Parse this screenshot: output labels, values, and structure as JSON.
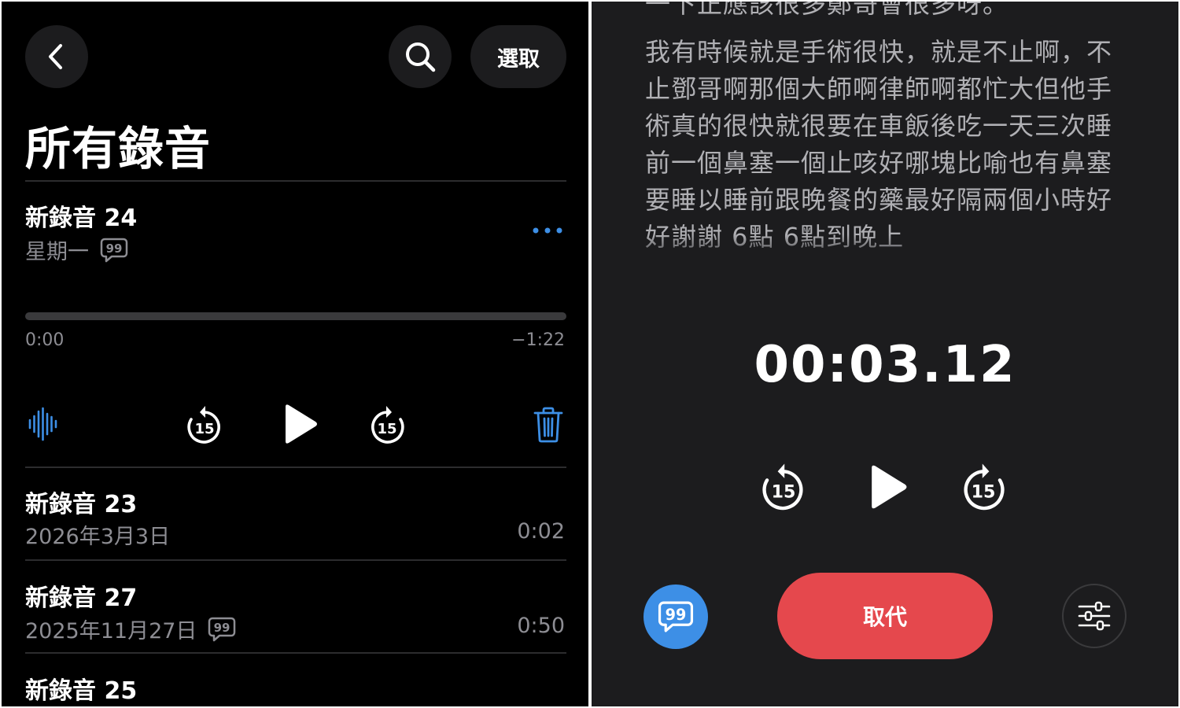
{
  "left_panel": {
    "header": {
      "select_label": "選取"
    },
    "title": "所有錄音",
    "expanded_recording": {
      "name": "新錄音 24",
      "date": "星期一",
      "progress_fraction": 0,
      "elapsed": "0:00",
      "remaining": "−1:22"
    },
    "recordings": [
      {
        "name": "新錄音 23",
        "date": "2026年3月3日",
        "duration": "0:02",
        "has_transcript": false
      },
      {
        "name": "新錄音 27",
        "date": "2025年11月27日",
        "duration": "0:50",
        "has_transcript": true
      },
      {
        "name": "新錄音 25",
        "date": "",
        "duration": "",
        "has_transcript": false
      }
    ],
    "skip_seconds": "15"
  },
  "right_panel": {
    "transcript": {
      "paragraph_1": "一下正應該很多鄭哥會很多呀。",
      "paragraph_2": "我有時候就是手術很快，就是不止啊，不止鄧哥啊那個大師啊律師啊都忙大但他手術真的很快就很要在車飯後吃一天三次睡前一個鼻塞一個止咳好哪塊比喻也有鼻塞要睡以睡前跟晚餐的藥最好隔兩個小時好好謝謝 6點 6點到晚上"
    },
    "timer": "00:03.12",
    "skip_seconds": "15",
    "replace_label": "取代"
  },
  "colors": {
    "accent_blue": "#3d8fe6",
    "destructive_red": "#e5484d",
    "left_background": "#000000",
    "right_background": "#1c1c1e"
  },
  "icons": [
    "back-icon",
    "search-icon",
    "more-icon",
    "transcript-icon",
    "waveform-icon",
    "skip-back-15-icon",
    "play-icon",
    "skip-forward-15-icon",
    "trash-icon",
    "options-icon"
  ]
}
